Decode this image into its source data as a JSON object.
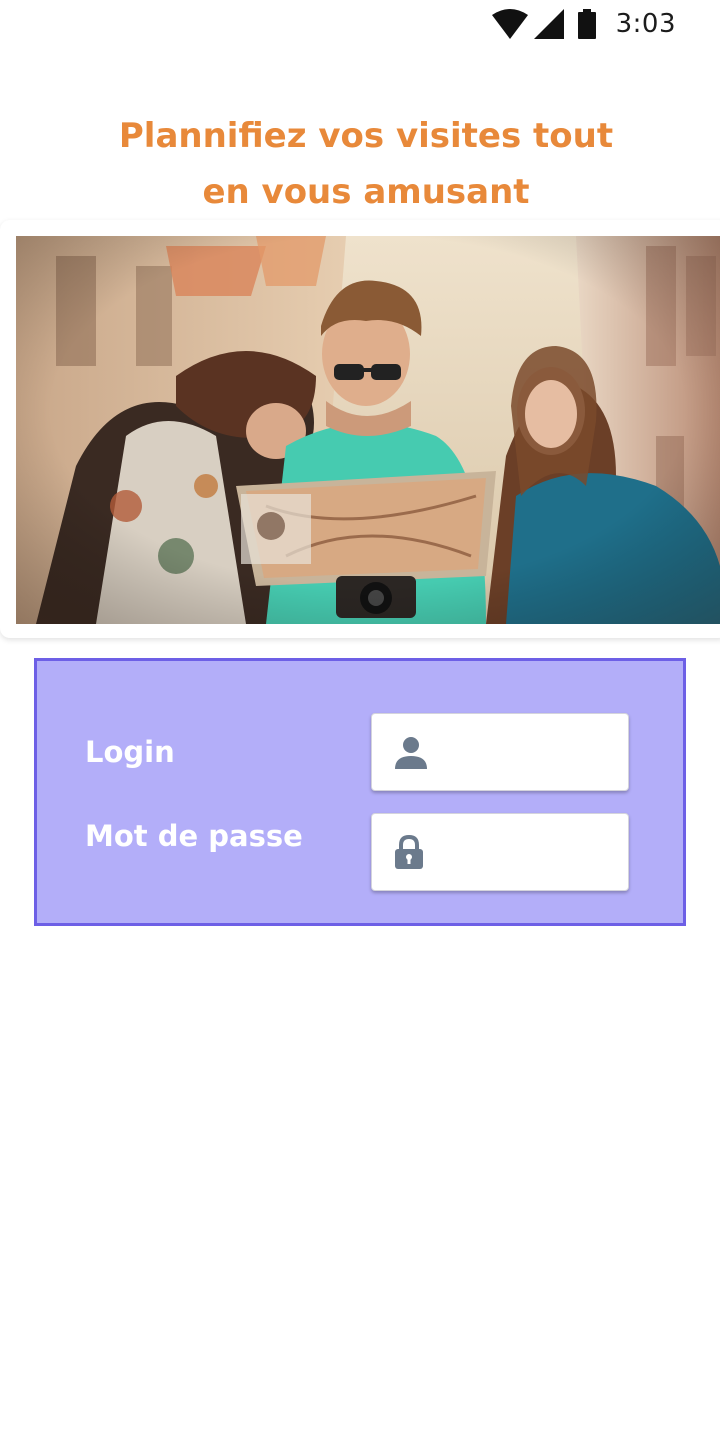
{
  "status_bar": {
    "time": "3:03",
    "icons": [
      "wifi-icon",
      "cellular-signal-icon",
      "battery-icon"
    ]
  },
  "header": {
    "title": "Plannifiez vos visites tout\nen vous amusant",
    "title_color": "#e8893a"
  },
  "hero": {
    "image": "travelers-with-map-photo"
  },
  "login_form": {
    "panel_color": "#b3aef9",
    "border_color": "#6d5fe6",
    "login_label": "Login",
    "password_label": "Mot de passe",
    "login_value": "",
    "password_value": "",
    "login_icon": "user-icon",
    "password_icon": "lock-icon",
    "icon_color": "#6b7a8c"
  }
}
